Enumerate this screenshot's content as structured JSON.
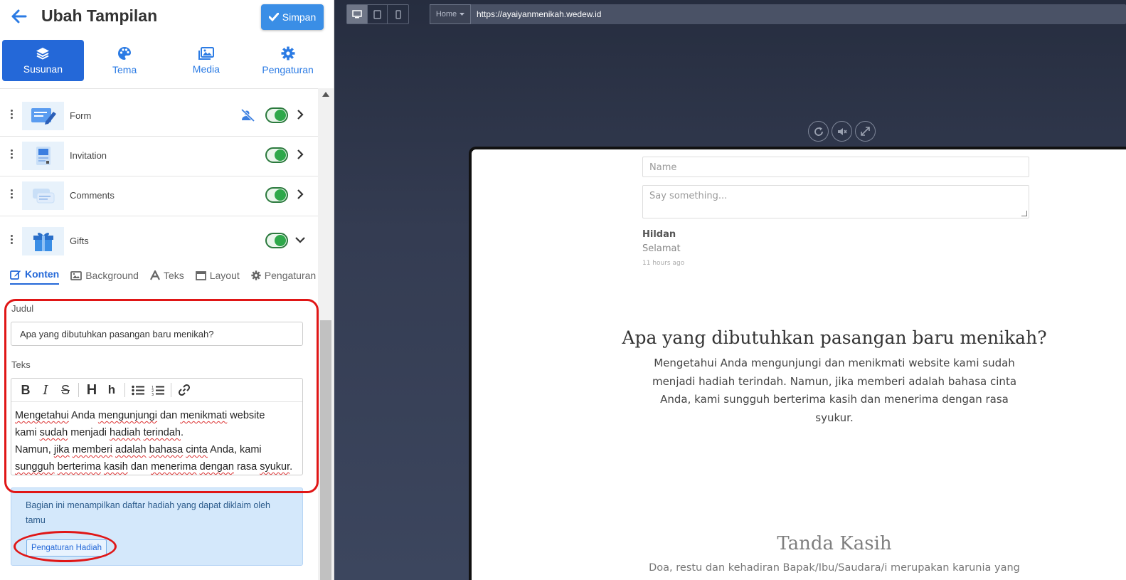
{
  "header": {
    "title": "Ubah Tampilan",
    "save_label": "Simpan"
  },
  "main_tabs": [
    {
      "label": "Susunan",
      "icon": "layers-icon",
      "active": true
    },
    {
      "label": "Tema",
      "icon": "palette-icon"
    },
    {
      "label": "Media",
      "icon": "images-icon"
    },
    {
      "label": "Pengaturan",
      "icon": "gear-icon"
    }
  ],
  "sections": [
    {
      "label": "Form",
      "enabled": true,
      "hidden_icon": true
    },
    {
      "label": "Invitation",
      "enabled": true
    },
    {
      "label": "Comments",
      "enabled": true
    },
    {
      "label": "Gifts",
      "enabled": true,
      "expanded": true
    }
  ],
  "sub_tabs": [
    {
      "label": "Konten",
      "icon": "edit-icon",
      "active": true
    },
    {
      "label": "Background",
      "icon": "image-icon"
    },
    {
      "label": "Teks",
      "icon": "text-icon"
    },
    {
      "label": "Layout",
      "icon": "window-icon"
    },
    {
      "label": "Pengaturan",
      "icon": "gear-icon"
    }
  ],
  "form": {
    "judul_label": "Judul",
    "judul_value": "Apa yang dibutuhkan pasangan baru menikah?",
    "teks_label": "Teks",
    "toolbar": [
      "B",
      "I",
      "S",
      "H",
      "h",
      "ul",
      "ol",
      "link"
    ]
  },
  "info": {
    "text": "Bagian ini menampilkan daftar hadiah yang dapat diklaim oleh tamu",
    "button_label": "Pengaturan Hadiah"
  },
  "preview": {
    "page_select": "Home",
    "url": "https://ayaiyanmenikah.wedew.id",
    "name_placeholder": "Name",
    "message_placeholder": "Say something...",
    "comment": {
      "name": "Hildan",
      "message": "Selamat",
      "time": "11 hours ago"
    },
    "gift_title": "Apa yang dibutuhkan pasangan baru menikah?",
    "gift_text": "Mengetahui Anda mengunjungi dan menikmati website kami sudah menjadi hadiah terindah. Namun, jika memberi adalah bahasa cinta Anda, kami sungguh berterima kasih dan menerima dengan rasa syukur.",
    "next_title": "Tanda Kasih",
    "next_text": "Doa, restu dan kehadiran Bapak/Ibu/Saudara/i merupakan karunia yang"
  },
  "colors": {
    "accent": "#2468d8",
    "save": "#3a8ee6",
    "toggle_on": "#2ea84a",
    "annotation": "#e01616"
  }
}
